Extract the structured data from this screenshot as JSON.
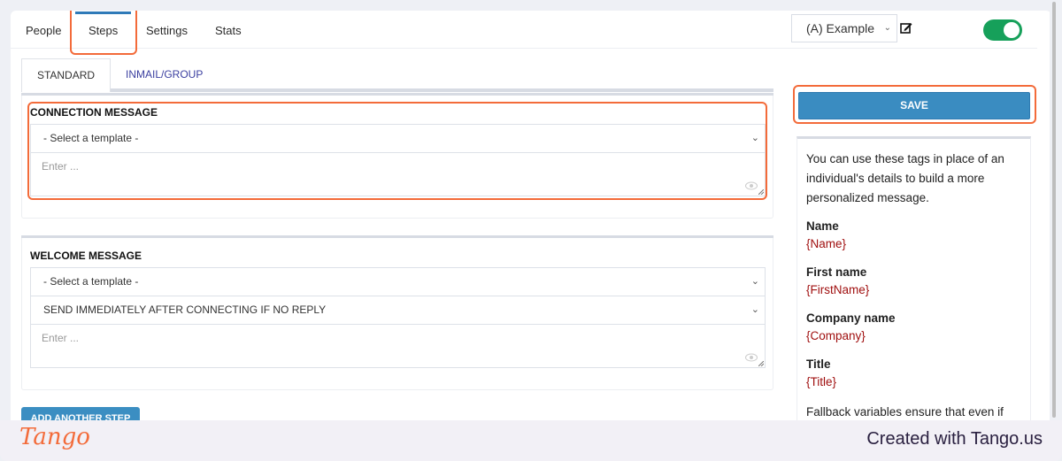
{
  "topnav": {
    "tabs": [
      {
        "label": "People"
      },
      {
        "label": "Steps",
        "active": true
      },
      {
        "label": "Settings"
      },
      {
        "label": "Stats"
      }
    ],
    "campaign_select": {
      "value": "(A) Example"
    },
    "toggle": {
      "on": true,
      "color": "#16a05a"
    }
  },
  "subtabs": [
    {
      "label": "STANDARD",
      "active": true
    },
    {
      "label": "INMAIL/GROUP"
    }
  ],
  "steps": [
    {
      "title": "CONNECTION MESSAGE",
      "template_select": "- Select a template -",
      "message_placeholder": "Enter ..."
    },
    {
      "title": "WELCOME MESSAGE",
      "template_select": "- Select a template -",
      "timing_select": "SEND IMMEDIATELY AFTER CONNECTING IF NO REPLY",
      "message_placeholder": "Enter ..."
    }
  ],
  "add_step_label": "ADD ANOTHER STEP",
  "save_label": "SAVE",
  "help": {
    "intro": "You can use these tags in place of an individual's details to build a more personalized message.",
    "tags": [
      {
        "name": "Name",
        "tag": "{Name}"
      },
      {
        "name": "First name",
        "tag": "{FirstName}"
      },
      {
        "name": "Company name",
        "tag": "{Company}"
      },
      {
        "name": "Title",
        "tag": "{Title}"
      }
    ],
    "fallback": "Fallback variables ensure that even if"
  },
  "footer": {
    "logo": "Tango",
    "created": "Created with Tango.us"
  },
  "colors": {
    "accent": "#3a8cc1",
    "highlight": "#f36b3a",
    "tag": "#a01010"
  }
}
